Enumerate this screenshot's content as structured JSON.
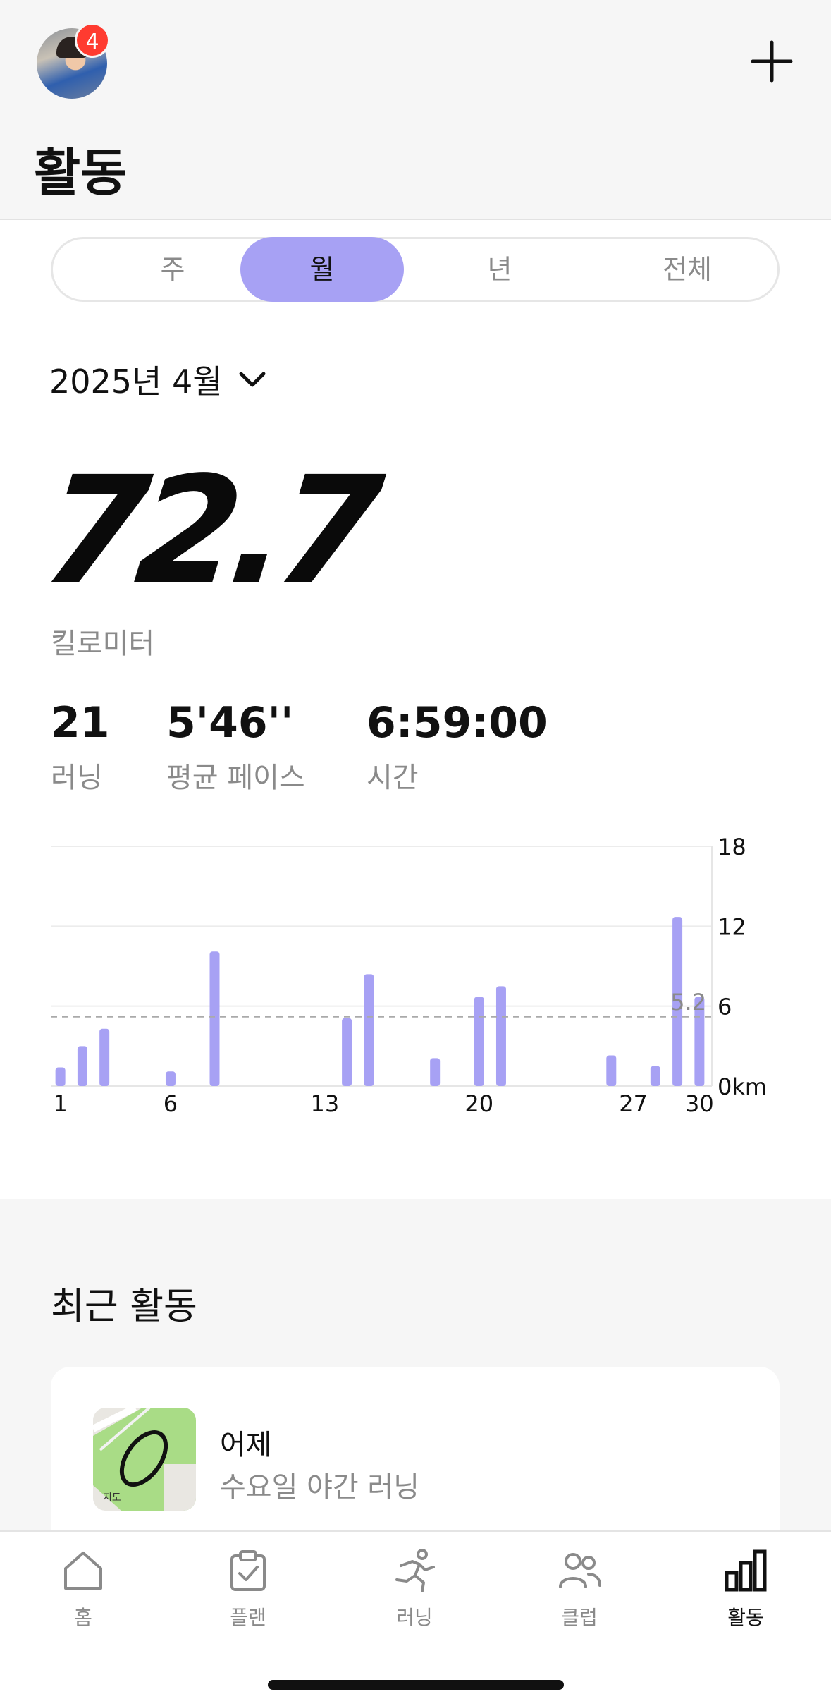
{
  "header": {
    "notification_count": "4",
    "title": "활동"
  },
  "segments": {
    "items": [
      "주",
      "월",
      "년",
      "전체"
    ],
    "active_index": 1
  },
  "period": {
    "label": "2025년 4월"
  },
  "summary": {
    "distance": "72.7",
    "distance_unit": "킬로미터",
    "runs_value": "21",
    "runs_label": "러닝",
    "pace_value": "5'46''",
    "pace_label": "평균 페이스",
    "time_value": "6:59:00",
    "time_label": "시간"
  },
  "chart_data": {
    "type": "bar",
    "x": [
      1,
      2,
      3,
      4,
      5,
      6,
      7,
      8,
      9,
      10,
      11,
      12,
      13,
      14,
      15,
      16,
      17,
      18,
      19,
      20,
      21,
      22,
      23,
      24,
      25,
      26,
      27,
      28,
      29,
      30
    ],
    "values": [
      1.4,
      3.0,
      4.3,
      0,
      0,
      1.1,
      0,
      10.1,
      0,
      0,
      0,
      0,
      0,
      5.1,
      8.4,
      0,
      0,
      2.1,
      0,
      6.7,
      7.5,
      0,
      0,
      0,
      0,
      2.3,
      0,
      1.5,
      12.7,
      6.7
    ],
    "x_tick_labels": [
      "1",
      "6",
      "13",
      "20",
      "27",
      "30"
    ],
    "y_tick_labels": [
      "18",
      "12",
      "6",
      "0km"
    ],
    "ylim": [
      0,
      18
    ],
    "average_value": 5.2,
    "average_label": "5.2",
    "bar_color": "#a7a1f4",
    "grid": true
  },
  "recent": {
    "title": "최근 활동",
    "card_title": "어제",
    "card_subtitle": "수요일 야간 러닝",
    "map_label": "지도"
  },
  "tabbar": {
    "items": [
      "홈",
      "플랜",
      "러닝",
      "클럽",
      "활동"
    ],
    "active_index": 4
  },
  "colors": {
    "accent": "#a7a1f4",
    "badge": "#ff3b30",
    "secondary_text": "#8a8a8a"
  }
}
